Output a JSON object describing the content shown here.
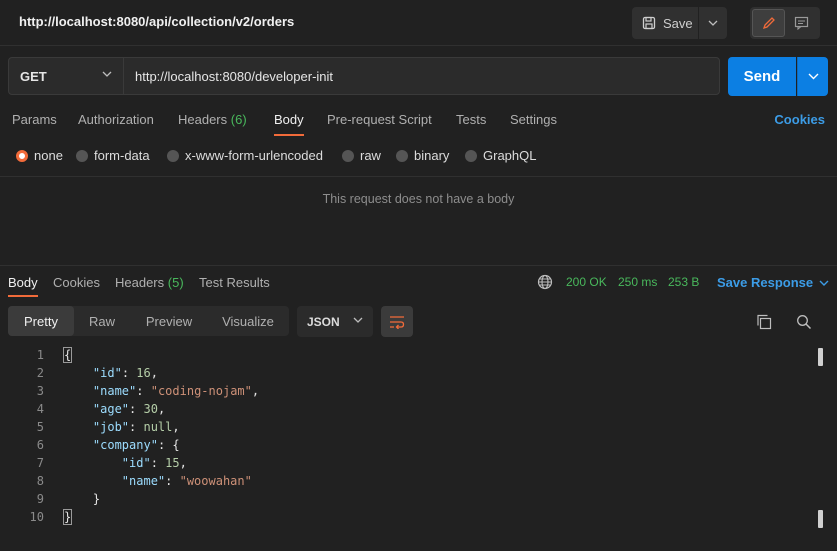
{
  "header": {
    "title": "http://localhost:8080/api/collection/v2/orders",
    "save_label": "Save"
  },
  "request": {
    "method": "GET",
    "url": "http://localhost:8080/developer-init",
    "send_label": "Send"
  },
  "request_tabs": {
    "params": "Params",
    "authorization": "Authorization",
    "headers": "Headers",
    "headers_count": "(6)",
    "body": "Body",
    "prerequest": "Pre-request Script",
    "tests": "Tests",
    "settings": "Settings",
    "cookies": "Cookies"
  },
  "body_types": {
    "none": "none",
    "form_data": "form-data",
    "urlencoded": "x-www-form-urlencoded",
    "raw": "raw",
    "binary": "binary",
    "graphql": "GraphQL",
    "selected": "none"
  },
  "empty_body_message": "This request does not have a body",
  "response": {
    "tabs": {
      "body": "Body",
      "cookies": "Cookies",
      "headers": "Headers",
      "headers_count": "(5)",
      "test_results": "Test Results"
    },
    "status": "200 OK",
    "time": "250 ms",
    "size": "253 B",
    "save_label": "Save Response",
    "formats": {
      "pretty": "Pretty",
      "raw": "Raw",
      "preview": "Preview",
      "visualize": "Visualize"
    },
    "language": "JSON",
    "lines": {
      "n1": "1",
      "n2": "2",
      "n3": "3",
      "n4": "4",
      "n5": "5",
      "n6": "6",
      "n7": "7",
      "n8": "8",
      "n9": "9",
      "n10": "10",
      "open_brace": "{",
      "id_key": "\"id\"",
      "id_val": "16",
      "name_key": "\"name\"",
      "name_val": "\"coding-nojam\"",
      "age_key": "\"age\"",
      "age_val": "30",
      "job_key": "\"job\"",
      "job_val": "null",
      "company_key": "\"company\"",
      "company_id_key": "\"id\"",
      "company_id_val": "15",
      "company_name_key": "\"name\"",
      "company_name_val": "\"woowahan\"",
      "inner_close": "}",
      "close_brace": "}"
    }
  },
  "colors": {
    "accent": "#f26b3a",
    "send": "#0c7fe3",
    "status_ok": "#49b85c",
    "link": "#3c9ce6"
  }
}
